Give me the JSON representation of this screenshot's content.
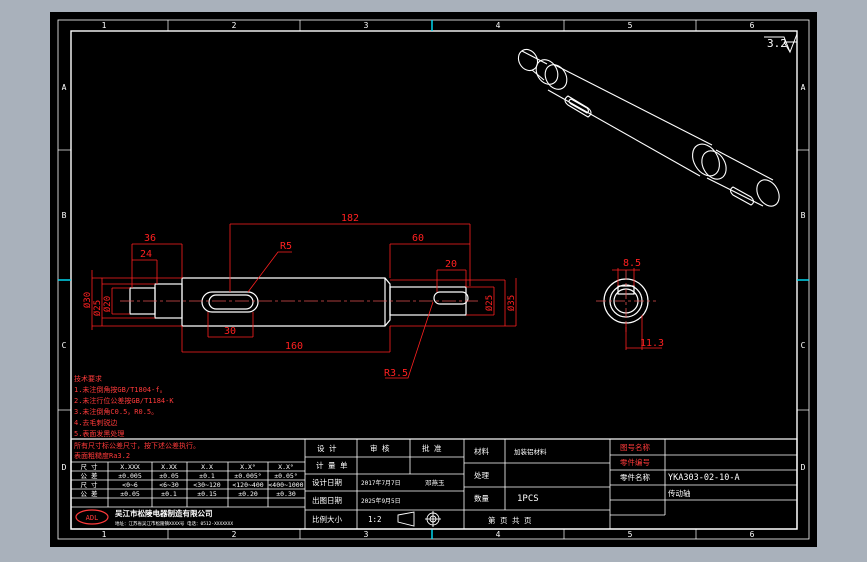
{
  "colors": {
    "background": "#a9b1bb",
    "sheet": "#000000",
    "frame": "#ffffff",
    "dimension": "#ff2020",
    "centerline": "#e05050",
    "table_text": "#ff3a3a",
    "cyan": "#00e5ff"
  },
  "grid": {
    "columns": [
      "1",
      "2",
      "3",
      "4",
      "5",
      "6"
    ],
    "rows": [
      "A",
      "B",
      "C",
      "D"
    ]
  },
  "roughness": "3.2",
  "dimensions": {
    "d182": "182",
    "d60": "60",
    "d36": "36",
    "d24": "24",
    "r5": "R5",
    "d20": "20",
    "d30": "30",
    "d160": "160",
    "r35": "R3.5",
    "dia30": "Ø30",
    "dia25_l": "Ø25",
    "dia20_l": "Ø20",
    "dia25_r": "Ø25",
    "dia35": "Ø35",
    "d85": "8.5",
    "d113": "11.3"
  },
  "tech_requirements": {
    "title": "技术要求",
    "lines": [
      "1.未注倒角按GB/T1804-f。",
      "2.未注行位公差按GB/T1184-K",
      "3.未注倒角C0.5，R0.5。",
      "4.去毛刺锐边",
      "5.表面发黑处理"
    ]
  },
  "tolerance_table": {
    "note1": "所有尺寸标公差尺寸，按下述公差执行。",
    "note2": "表面粗糙度Ra3.2",
    "header": [
      "尺 寸",
      "X.XXX",
      "X.XX",
      "X.X",
      "X.X°",
      "X.X°"
    ],
    "row_a": [
      "公 差",
      "±0.005",
      "±0.05",
      "±0.1",
      "±0.005°",
      "±0.05°"
    ],
    "row_b": [
      "尺 寸",
      "<0~6",
      "<6~30",
      "<30~120",
      "<120~400",
      "<400~1000"
    ],
    "row_c": [
      "公 差",
      "±0.05",
      "±0.1",
      "±0.15",
      "±0.20",
      "±0.30"
    ]
  },
  "company": {
    "logo": "ADL",
    "name": "吴江市松陵电器制造有限公司",
    "address": "地址：江苏省吴江市松陵镇XXXX号 电话：0512-XXXXXXX"
  },
  "title_block": {
    "design": "设 计",
    "review": "审 核",
    "approve": "批 准",
    "drafter_label": "计 量 单",
    "date_label": "设计日期",
    "date_value": "2017年7月7日",
    "designer_name": "邓燕玉",
    "issue_label": "出图日期",
    "issue_value": "2025年9月5日",
    "scale_label": "比例大小",
    "scale_value": "1:2",
    "material_label": "材料",
    "material_value": "加装铝材料",
    "treatment_label": "处理",
    "qty_label": "数量",
    "qty_value": "1PCS",
    "sheet_label": "第 页 共 页",
    "drawing_no_label": "图号名称",
    "part_no_label": "零件编号",
    "part_no_value": "YKA303-02-10-A",
    "part_name_label": "零件名称",
    "part_name_value": "传动轴"
  }
}
